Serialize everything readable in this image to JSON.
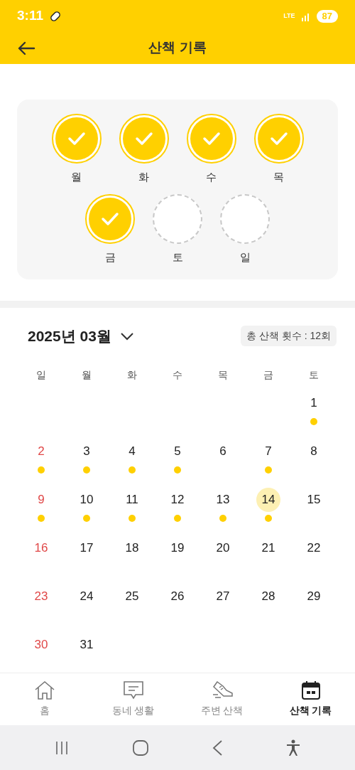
{
  "status_bar": {
    "time": "3:11",
    "network": "LTE",
    "battery": "87"
  },
  "header": {
    "title": "산책 기록"
  },
  "week": [
    {
      "label": "월",
      "done": true
    },
    {
      "label": "화",
      "done": true
    },
    {
      "label": "수",
      "done": true
    },
    {
      "label": "목",
      "done": true
    },
    {
      "label": "금",
      "done": true
    },
    {
      "label": "토",
      "done": false
    },
    {
      "label": "일",
      "done": false
    }
  ],
  "calendar": {
    "month": "2025년 03월",
    "total": "총 산책 횟수 : 12회",
    "weekdays": [
      "일",
      "월",
      "화",
      "수",
      "목",
      "금",
      "토"
    ],
    "weeks": [
      [
        {
          "day": "1",
          "walked": true,
          "today": false
        }
      ],
      [
        {
          "day": "2",
          "walked": true,
          "today": false
        },
        {
          "day": "3",
          "walked": true,
          "today": false
        },
        {
          "day": "4",
          "walked": true,
          "today": false
        },
        {
          "day": "5",
          "walked": true,
          "today": false
        },
        {
          "day": "6",
          "walked": false,
          "today": false
        },
        {
          "day": "7",
          "walked": true,
          "today": false
        },
        {
          "day": "8",
          "walked": false,
          "today": false
        }
      ],
      [
        {
          "day": "9",
          "walked": true,
          "today": false
        },
        {
          "day": "10",
          "walked": true,
          "today": false
        },
        {
          "day": "11",
          "walked": true,
          "today": false
        },
        {
          "day": "12",
          "walked": true,
          "today": false
        },
        {
          "day": "13",
          "walked": true,
          "today": false
        },
        {
          "day": "14",
          "walked": true,
          "today": true
        },
        {
          "day": "15",
          "walked": false,
          "today": false
        }
      ],
      [
        {
          "day": "16",
          "walked": false,
          "today": false
        },
        {
          "day": "17",
          "walked": false,
          "today": false
        },
        {
          "day": "18",
          "walked": false,
          "today": false
        },
        {
          "day": "19",
          "walked": false,
          "today": false
        },
        {
          "day": "20",
          "walked": false,
          "today": false
        },
        {
          "day": "21",
          "walked": false,
          "today": false
        },
        {
          "day": "22",
          "walked": false,
          "today": false
        }
      ],
      [
        {
          "day": "23",
          "walked": false,
          "today": false
        },
        {
          "day": "24",
          "walked": false,
          "today": false
        },
        {
          "day": "25",
          "walked": false,
          "today": false
        },
        {
          "day": "26",
          "walked": false,
          "today": false
        },
        {
          "day": "27",
          "walked": false,
          "today": false
        },
        {
          "day": "28",
          "walked": false,
          "today": false
        },
        {
          "day": "29",
          "walked": false,
          "today": false
        }
      ],
      [
        {
          "day": "30",
          "walked": false,
          "today": false
        },
        {
          "day": "31",
          "walked": false,
          "today": false
        }
      ]
    ]
  },
  "bottom_nav": [
    {
      "label": "홈",
      "kind": "home",
      "selected": false
    },
    {
      "label": "동네 생활",
      "kind": "chat",
      "selected": false
    },
    {
      "label": "주변 산책",
      "kind": "shoe",
      "selected": false
    },
    {
      "label": "산책 기록",
      "kind": "calendar",
      "selected": true
    }
  ]
}
